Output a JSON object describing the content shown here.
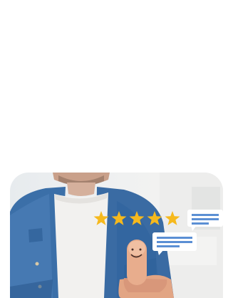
{
  "hero": {
    "rating": 5,
    "rating_max": 5,
    "star_color": "#f6b91d",
    "bubble_color": "#5b8fd4"
  }
}
